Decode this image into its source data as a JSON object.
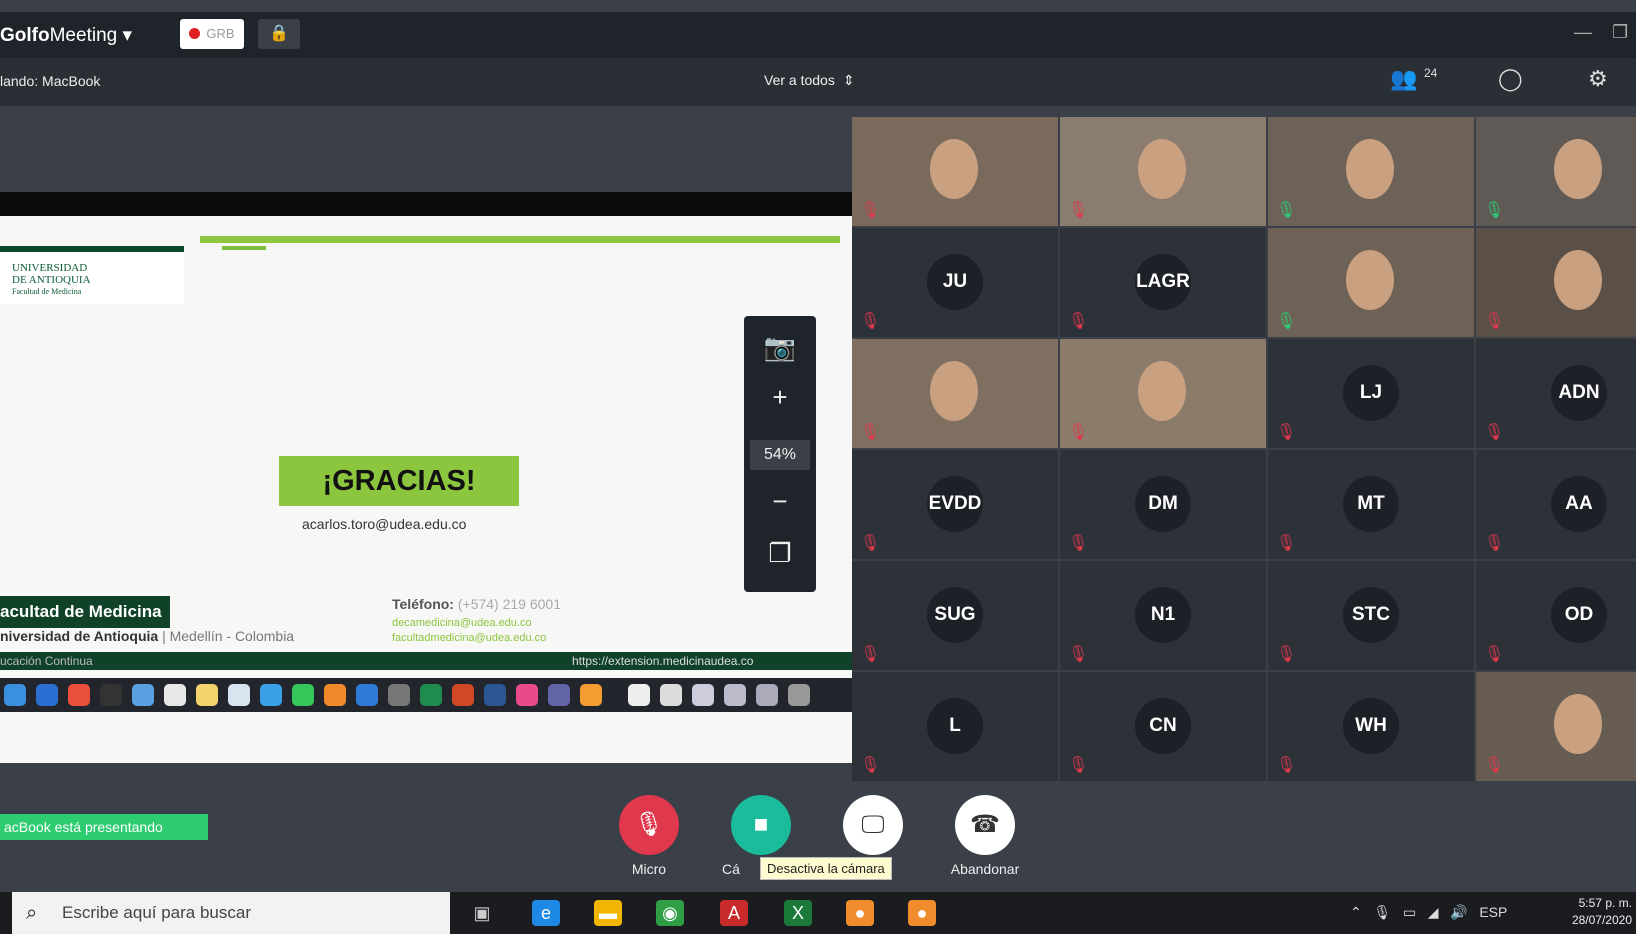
{
  "app": {
    "brand_bold": "Golfo",
    "brand_rest": "Meeting",
    "dropdown": "▾",
    "rec_label": "GRB",
    "speaking_label": "lando: MacBook",
    "view_label": "Ver a todos",
    "participant_count": "24"
  },
  "slide": {
    "logo_line1": "UNIVERSIDAD",
    "logo_line2": "DE ANTIOQUIA",
    "logo_line3": "Facultad de Medicina",
    "gracias": "¡GRACIAS!",
    "email": "acarlos.toro@udea.edu.co",
    "faculty": "acultad de Medicina",
    "university": "niversidad de Antioquia",
    "city": "| Medellín - Colombia",
    "tel_label": "Teléfono:",
    "tel_value": "(+574) 219 6001",
    "mail1": "decamedicina@udea.edu.co",
    "mail2": "facultadmedicina@udea.edu.co",
    "footer_left": "ucación Continua",
    "footer_right": "https://extension.medicinaudea.co"
  },
  "zoom": {
    "percent": "54%"
  },
  "presenting_label": "acBook está presentando",
  "participants": [
    {
      "initials": "",
      "video": true,
      "mic": "off"
    },
    {
      "initials": "",
      "video": true,
      "mic": "off"
    },
    {
      "initials": "",
      "video": true,
      "mic": "on"
    },
    {
      "initials": "",
      "video": true,
      "mic": "on"
    },
    {
      "initials": "JU",
      "video": false,
      "mic": "off"
    },
    {
      "initials": "LAGR",
      "video": false,
      "mic": "off"
    },
    {
      "initials": "",
      "video": true,
      "mic": "on"
    },
    {
      "initials": "",
      "video": true,
      "mic": "off"
    },
    {
      "initials": "",
      "video": true,
      "mic": "off"
    },
    {
      "initials": "",
      "video": true,
      "mic": "off"
    },
    {
      "initials": "LJ",
      "video": false,
      "mic": "off"
    },
    {
      "initials": "ADN",
      "video": false,
      "mic": "off"
    },
    {
      "initials": "EVDD",
      "video": false,
      "mic": "off"
    },
    {
      "initials": "DM",
      "video": false,
      "mic": "off"
    },
    {
      "initials": "MT",
      "video": false,
      "mic": "off"
    },
    {
      "initials": "AA",
      "video": false,
      "mic": "off"
    },
    {
      "initials": "SUG",
      "video": false,
      "mic": "off"
    },
    {
      "initials": "N1",
      "video": false,
      "mic": "off"
    },
    {
      "initials": "STC",
      "video": false,
      "mic": "off"
    },
    {
      "initials": "OD",
      "video": false,
      "mic": "off"
    },
    {
      "initials": "L",
      "video": false,
      "mic": "off"
    },
    {
      "initials": "CN",
      "video": false,
      "mic": "off"
    },
    {
      "initials": "WH",
      "video": false,
      "mic": "off"
    },
    {
      "initials": "",
      "video": true,
      "mic": "off"
    }
  ],
  "controls": {
    "mic_label": "Micro",
    "cam_label": "Cá",
    "tooltip": "Desactiva la cámara",
    "leave_label": "Abandonar",
    "mic_color": "#e0384d",
    "cam_color": "#1abc9c"
  },
  "taskbar": {
    "search_placeholder": "Escribe aquí para buscar",
    "lang": "ESP",
    "time": "5:57 p. m.",
    "date": "28/07/2020"
  }
}
